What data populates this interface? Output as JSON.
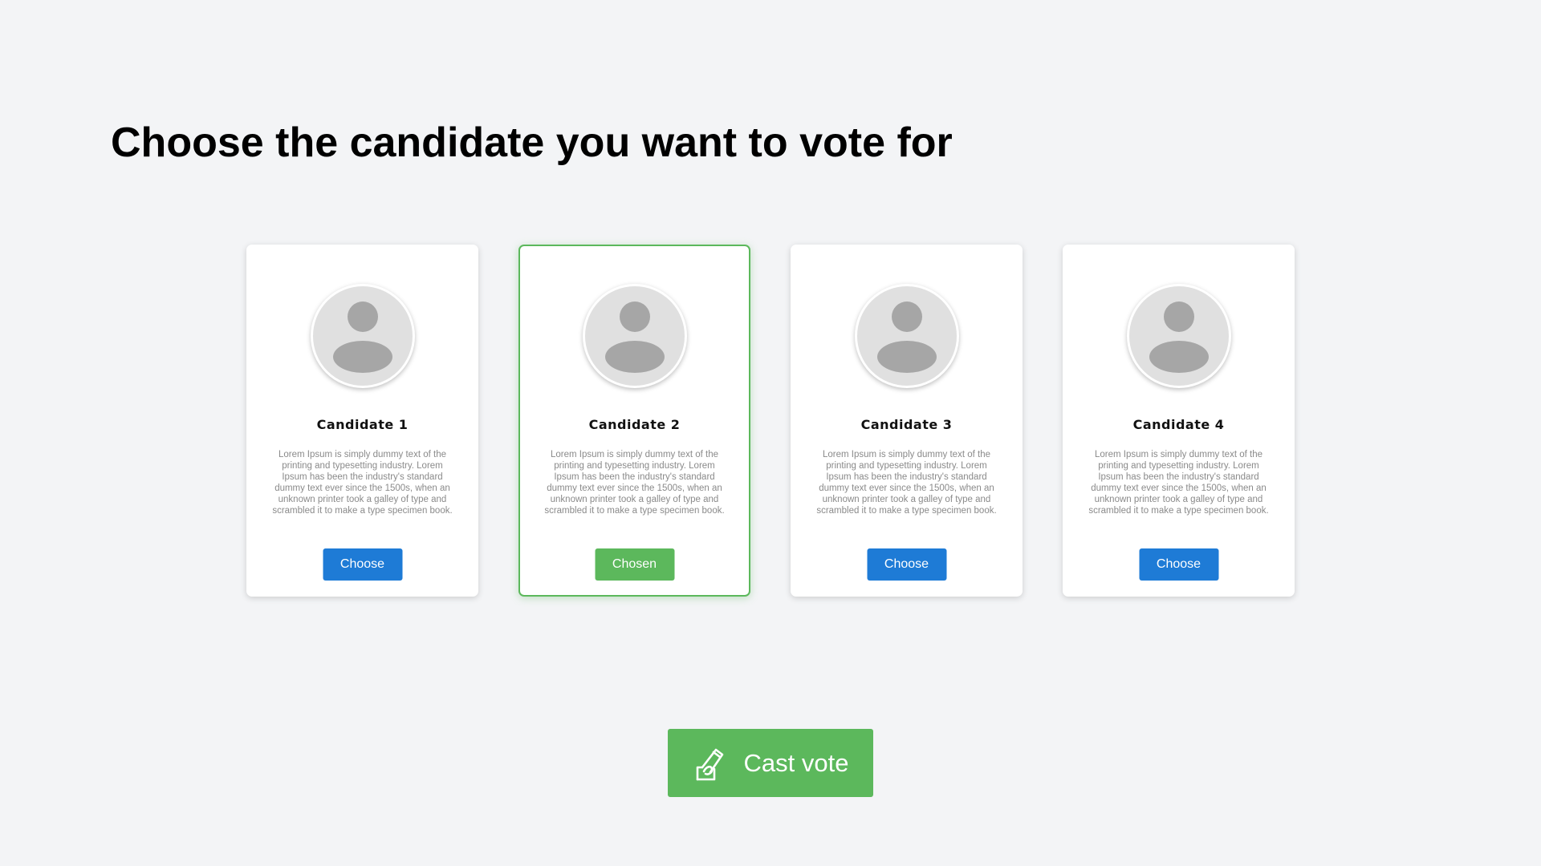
{
  "header": {
    "title": "Choose the candidate you want to vote for"
  },
  "candidates": [
    {
      "name": "Candidate 1",
      "description": "Lorem Ipsum is simply dummy text of the printing and typesetting industry. Lorem Ipsum has been the industry's standard dummy text ever since the 1500s, when an unknown printer took a galley of type and scrambled it to make a type specimen book.",
      "button_label": "Choose",
      "selected": false
    },
    {
      "name": "Candidate 2",
      "description": "Lorem Ipsum is simply dummy text of the printing and typesetting industry. Lorem Ipsum has been the industry's standard dummy text ever since the 1500s, when an unknown printer took a galley of type and scrambled it to make a type specimen book.",
      "button_label": "Chosen",
      "selected": true
    },
    {
      "name": "Candidate 3",
      "description": "Lorem Ipsum is simply dummy text of the printing and typesetting industry. Lorem Ipsum has been the industry's standard dummy text ever since the 1500s, when an unknown printer took a galley of type and scrambled it to make a type specimen book.",
      "button_label": "Choose",
      "selected": false
    },
    {
      "name": "Candidate 4",
      "description": "Lorem Ipsum is simply dummy text of the printing and typesetting industry. Lorem Ipsum has been the industry's standard dummy text ever since the 1500s, when an unknown printer took a galley of type and scrambled it to make a type specimen book.",
      "button_label": "Choose",
      "selected": false
    }
  ],
  "cast_vote": {
    "label": "Cast vote",
    "icon": "ballot-vote-icon"
  },
  "icons": {
    "avatar": "user-avatar-icon"
  },
  "colors": {
    "background": "#f3f4f6",
    "choose_button": "#1e7bd6",
    "chosen_accent": "#5cb85c",
    "avatar_bg": "#e0e0e0",
    "avatar_figure": "#a6a6a6"
  }
}
